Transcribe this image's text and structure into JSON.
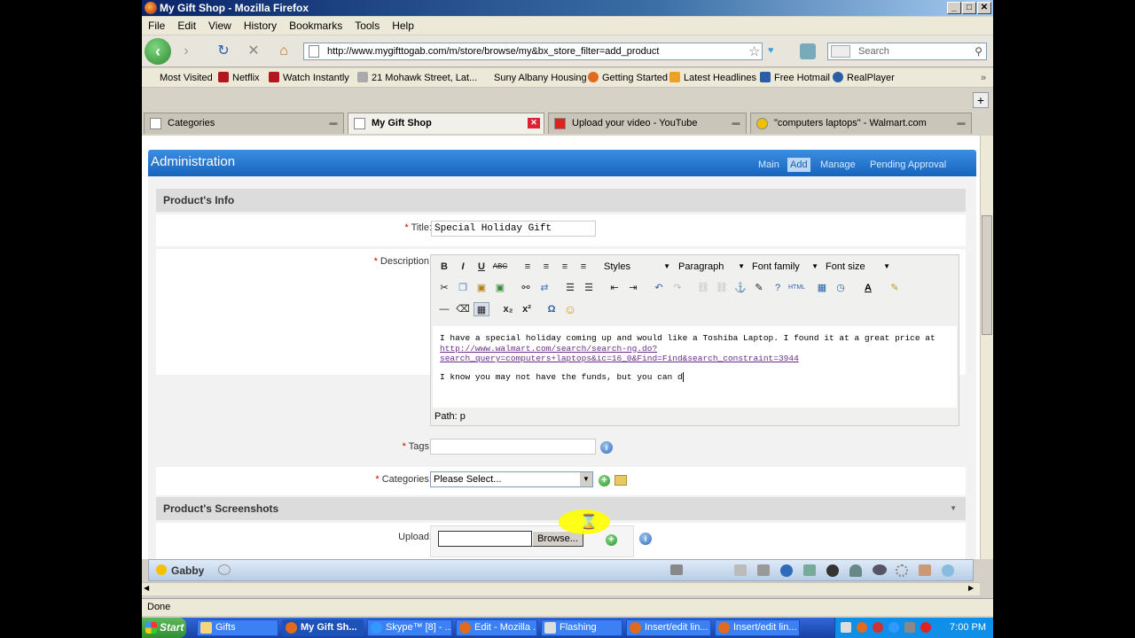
{
  "window": {
    "title": "My Gift Shop - Mozilla Firefox",
    "controls": [
      "_",
      "□",
      "✕"
    ]
  },
  "menu": [
    "File",
    "Edit",
    "View",
    "History",
    "Bookmarks",
    "Tools",
    "Help"
  ],
  "nav": {
    "url": "http://www.mygifttogab.com/m/store/browse/my&bx_store_filter=add_product",
    "search_placeholder": "Search"
  },
  "bookmarks": [
    {
      "label": "Most Visited",
      "color": "#4a7bc4"
    },
    {
      "label": "Netflix",
      "color": "#b0181e"
    },
    {
      "label": "Watch Instantly",
      "color": "#b0181e"
    },
    {
      "label": "21 Mohawk Street, Lat...",
      "color": "#888888"
    },
    {
      "label": "Suny Albany Housing",
      "color": "#ffffff"
    },
    {
      "label": "Getting Started",
      "color": "#e06b1f"
    },
    {
      "label": "Latest Headlines",
      "color": "#f0a020"
    },
    {
      "label": "Free Hotmail",
      "color": "#2a5fa8"
    },
    {
      "label": "RealPlayer",
      "color": "#2a5fa8"
    }
  ],
  "tabs": [
    {
      "label": "Categories",
      "active": false
    },
    {
      "label": "My Gift Shop",
      "active": true
    },
    {
      "label": "Upload your video - YouTube",
      "active": false
    },
    {
      "label": "\"computers laptops\" - Walmart.com",
      "active": false
    }
  ],
  "admin": {
    "title": "Administration",
    "nav": [
      "Main",
      "Add",
      "Manage",
      "Pending Approval"
    ],
    "selected_nav": "Add"
  },
  "form": {
    "section_info": "Product's Info",
    "title_label": "Title:",
    "title_value": "Special Holiday Gift",
    "description_label": "Description:",
    "tags_label": "Tags:",
    "categories_label": "Categories:",
    "categories_value": "Please Select...",
    "section_screenshots": "Product's Screenshots",
    "upload_label": "Upload:",
    "browse_label": "Browse...",
    "required_mark": "*"
  },
  "editor": {
    "buttons_row1": [
      "B",
      "I",
      "U",
      "ABC"
    ],
    "styles": "Styles",
    "paragraph": "Paragraph",
    "font_family": "Font family",
    "font_size": "Font size",
    "line1": "I have a special holiday coming up and would like a Toshiba Laptop.  I found it at a great price at",
    "link": "http://www.walmart.com/search/search-ng.do?search_query=computers+laptops&ic=16_0&Find=Find&search_constraint=3944",
    "line2": "I know you may not have the funds, but you can d",
    "path": "Path: p"
  },
  "chat": {
    "user": "Gabby"
  },
  "status": {
    "text": "Done"
  },
  "taskbar": {
    "start": "Start",
    "items": [
      {
        "label": "Gifts",
        "active": false
      },
      {
        "label": "My Gift Sh...",
        "active": true
      },
      {
        "label": "Skype™ [8] - ...",
        "active": false
      },
      {
        "label": "Edit - Mozilla ...",
        "active": false
      },
      {
        "label": "Flashing",
        "active": false
      },
      {
        "label": "Insert/edit lin...",
        "active": false
      },
      {
        "label": "Insert/edit lin...",
        "active": false
      }
    ],
    "clock": "7:00 PM"
  }
}
